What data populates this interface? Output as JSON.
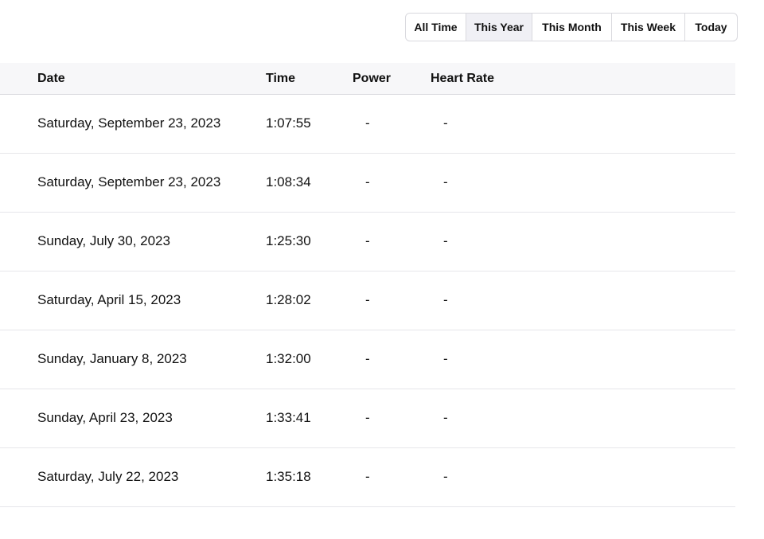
{
  "filters": [
    {
      "label": "All Time",
      "active": false
    },
    {
      "label": "This Year",
      "active": true
    },
    {
      "label": "This Month",
      "active": false
    },
    {
      "label": "This Week",
      "active": false
    },
    {
      "label": "Today",
      "active": false
    }
  ],
  "table": {
    "headers": {
      "date": "Date",
      "time": "Time",
      "power": "Power",
      "heart_rate": "Heart Rate"
    },
    "rows": [
      {
        "date": "Saturday, September 23, 2023",
        "time": "1:07:55",
        "power": "-",
        "heart_rate": "-"
      },
      {
        "date": "Saturday, September 23, 2023",
        "time": "1:08:34",
        "power": "-",
        "heart_rate": "-"
      },
      {
        "date": "Sunday, July 30, 2023",
        "time": "1:25:30",
        "power": "-",
        "heart_rate": "-"
      },
      {
        "date": "Saturday, April 15, 2023",
        "time": "1:28:02",
        "power": "-",
        "heart_rate": "-"
      },
      {
        "date": "Sunday, January 8, 2023",
        "time": "1:32:00",
        "power": "-",
        "heart_rate": "-"
      },
      {
        "date": "Sunday, April 23, 2023",
        "time": "1:33:41",
        "power": "-",
        "heart_rate": "-"
      },
      {
        "date": "Saturday, July 22, 2023",
        "time": "1:35:18",
        "power": "-",
        "heart_rate": "-"
      }
    ]
  }
}
